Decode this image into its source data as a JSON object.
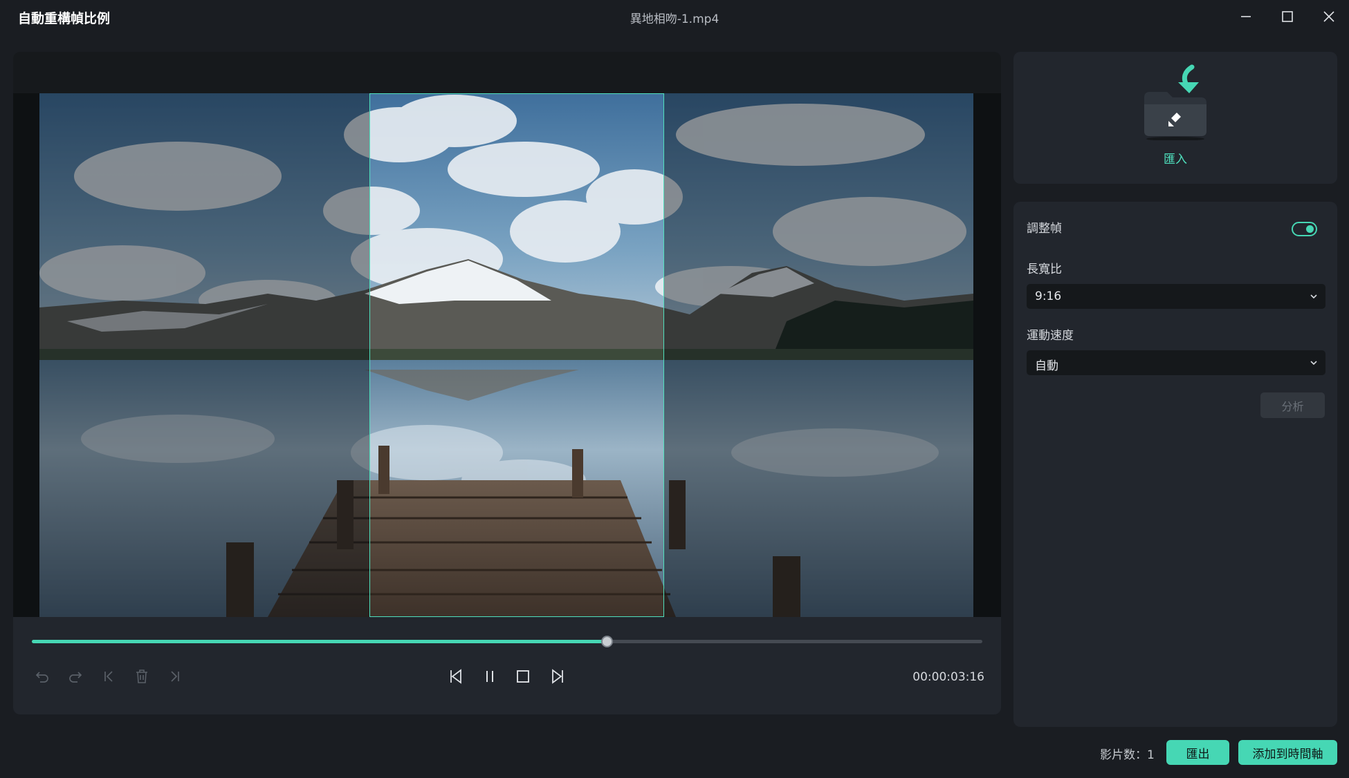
{
  "window": {
    "title": "自動重構幀比例",
    "file_name": "異地相吻-1.mp4",
    "controls": [
      "minimize-icon",
      "maximize-icon",
      "close-icon"
    ]
  },
  "player": {
    "progress": 0.605,
    "timecode": "00:00:03:16",
    "crop_aspect": "9:16",
    "left_controls": [
      "undo-icon",
      "redo-icon",
      "mark-in-icon",
      "delete-icon",
      "mark-out-icon"
    ],
    "center_controls": [
      "step-back-icon",
      "pause-icon",
      "stop-icon",
      "step-forward-icon"
    ]
  },
  "import": {
    "label": "匯入",
    "icon": "import-folder-icon"
  },
  "settings": {
    "adjust_frame_label": "調整幀",
    "adjust_frame_on": true,
    "aspect_ratio_label": "長寬比",
    "aspect_ratio_value": "9:16",
    "motion_speed_label": "運動速度",
    "motion_speed_value": "自動",
    "analyze_label": "分析"
  },
  "footer": {
    "clip_count": "影片数：1",
    "export_label": "匯出",
    "add_timeline_label": "添加到時間軸"
  },
  "colors": {
    "accent": "#46d7b4",
    "background": "#1a1d22",
    "panel": "#22262d"
  }
}
